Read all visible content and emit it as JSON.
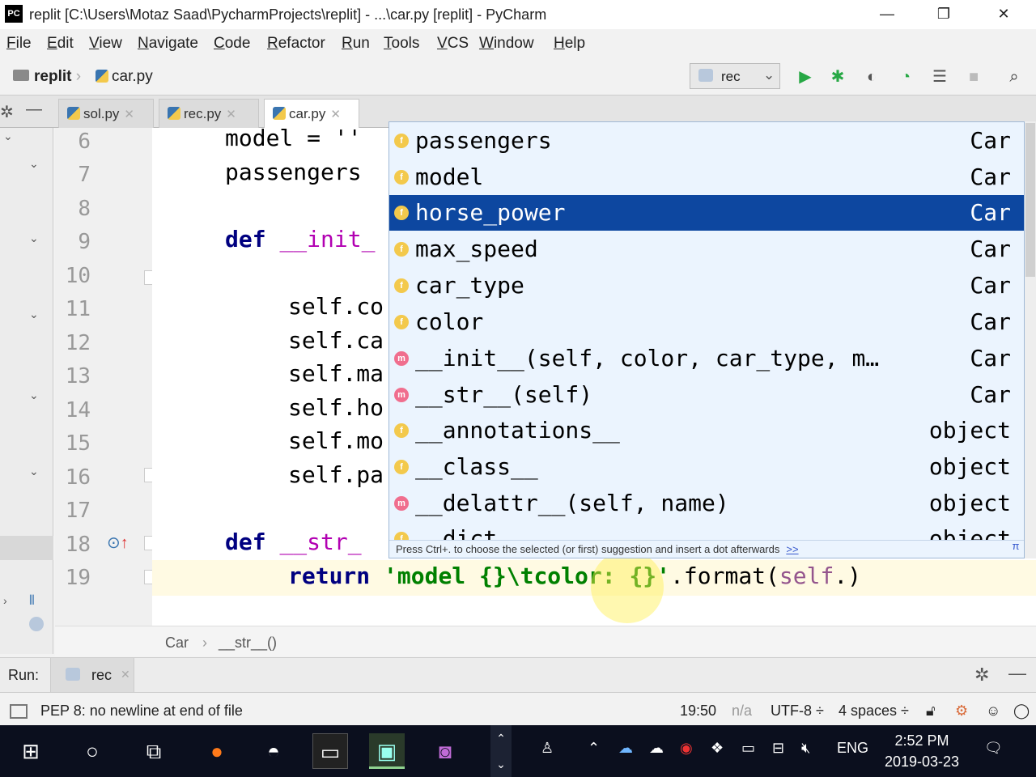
{
  "window": {
    "logo": "PC",
    "title": "replit [C:\\Users\\Motaz Saad\\PycharmProjects\\replit] - ...\\car.py [replit] - PyCharm",
    "minimize": "—",
    "restore": "❐",
    "close": "✕"
  },
  "menu": [
    {
      "u": "F",
      "rest": "ile"
    },
    {
      "u": "E",
      "rest": "dit"
    },
    {
      "u": "V",
      "rest": "iew"
    },
    {
      "u": "N",
      "rest": "avigate"
    },
    {
      "u": "C",
      "rest": "ode"
    },
    {
      "u": "R",
      "rest": "efactor"
    },
    {
      "u": "R",
      "rest": "un"
    },
    {
      "u": "T",
      "rest": "ools"
    },
    {
      "u": "V",
      "rest": "CS"
    },
    {
      "u": "W",
      "rest": "indow"
    },
    {
      "u": "H",
      "rest": "elp"
    }
  ],
  "nav": {
    "project": "replit",
    "file": "car.py",
    "run_config": "rec"
  },
  "tabs": [
    {
      "label": "sol.py"
    },
    {
      "label": "rec.py"
    },
    {
      "label": "car.py",
      "active": true
    }
  ],
  "gutter_lines": [
    "6",
    "7",
    "8",
    "9",
    "10",
    "11",
    "12",
    "13",
    "14",
    "15",
    "16",
    "17",
    "18",
    "19"
  ],
  "code": {
    "l6": "model = ''",
    "l7": "passengers",
    "l9_kw": "def",
    "l9_fn": "__init_",
    "l11": "self.co",
    "l12": "self.ca",
    "l13": "self.ma",
    "l14": "self.ho",
    "l15": "self.mo",
    "l16": "self.pa",
    "l18_kw": "def",
    "l18_fn": "__str_",
    "l19_kw": "return",
    "l19_str": "'model {}\\tcolor: {}'",
    "l19_mid": ".format(",
    "l19_self": "self",
    "l19_end": ".)"
  },
  "autocomplete": {
    "items": [
      {
        "kind": "f",
        "name": "passengers",
        "type": "Car"
      },
      {
        "kind": "f",
        "name": "model",
        "type": "Car"
      },
      {
        "kind": "f",
        "name": "horse_power",
        "type": "Car",
        "selected": true
      },
      {
        "kind": "f",
        "name": "max_speed",
        "type": "Car"
      },
      {
        "kind": "f",
        "name": "car_type",
        "type": "Car"
      },
      {
        "kind": "f",
        "name": "color",
        "type": "Car"
      },
      {
        "kind": "m",
        "name": "__init__(self, color, car_type, m…",
        "type": "Car"
      },
      {
        "kind": "m",
        "name": "__str__(self)",
        "type": "Car"
      },
      {
        "kind": "f",
        "name": "__annotations__",
        "type": "object"
      },
      {
        "kind": "f",
        "name": "__class__",
        "type": "object"
      },
      {
        "kind": "m",
        "name": "__delattr__(self, name)",
        "type": "object"
      },
      {
        "kind": "f",
        "name": "__dict__",
        "type": "object"
      }
    ],
    "hint": "Press Ctrl+. to choose the selected (or first) suggestion and insert a dot afterwards",
    "more": ">>",
    "pi": "π"
  },
  "editor_breadcrumb": {
    "cls": "Car",
    "sep": "›",
    "method": "__str__()"
  },
  "run": {
    "label": "Run:",
    "tab": "rec"
  },
  "status": {
    "message": "PEP 8: no newline at end of file",
    "position": "19:50",
    "na": "n/a",
    "encoding": "UTF-8 ÷",
    "indent": "4 spaces ÷"
  },
  "taskbar": {
    "lang": "ENG",
    "time": "2:52 PM",
    "date": "2019-03-23"
  },
  "colors": {
    "selection": "#0d47a0",
    "popup_bg": "#ebf4fe",
    "field_badge": "#f3c94c",
    "method_badge": "#f06e8e"
  }
}
